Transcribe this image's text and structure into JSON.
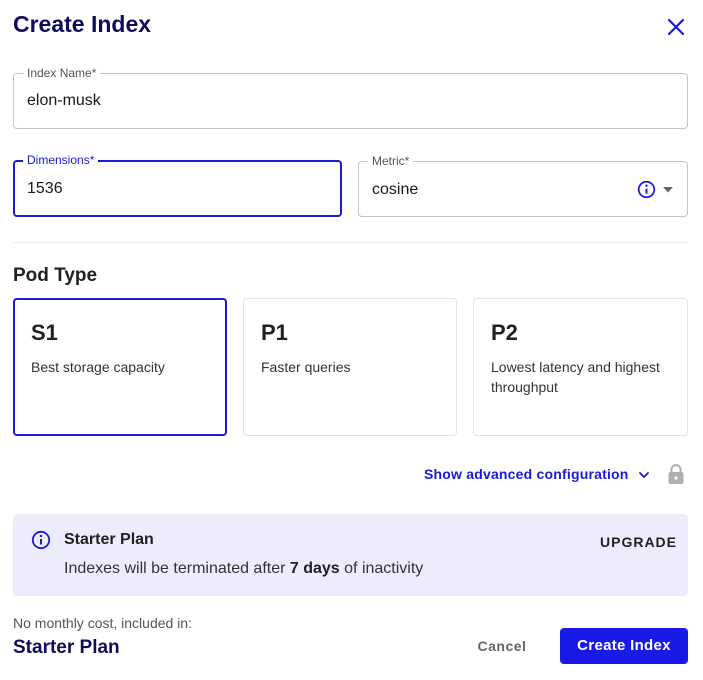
{
  "dialog": {
    "title": "Create Index"
  },
  "form": {
    "index_name": {
      "label": "Index Name",
      "required_mark": "*",
      "value": "elon-musk"
    },
    "dimensions": {
      "label": "Dimensions",
      "required_mark": "*",
      "value": "1536"
    },
    "metric": {
      "label": "Metric",
      "required_mark": "*",
      "value": "cosine"
    }
  },
  "pod_type": {
    "heading": "Pod Type",
    "options": [
      {
        "name": "S1",
        "description": "Best storage capacity",
        "selected": true
      },
      {
        "name": "P1",
        "description": "Faster queries",
        "selected": false
      },
      {
        "name": "P2",
        "description": "Lowest latency and highest throughput",
        "selected": false
      }
    ]
  },
  "advanced": {
    "label": "Show advanced configuration"
  },
  "plan_notice": {
    "title": "Starter Plan",
    "text_prefix": "Indexes will be terminated after ",
    "text_bold": "7 days",
    "text_suffix": " of inactivity",
    "upgrade_label": "UPGRADE"
  },
  "footer": {
    "cost_text": "No monthly cost, included in:",
    "plan_name": "Starter Plan",
    "cancel_label": "Cancel",
    "create_label": "Create Index"
  },
  "colors": {
    "accent": "#1a1ae6",
    "title": "#0d0d5c",
    "notice_bg": "#ececfd"
  },
  "icons": [
    "close-icon",
    "info-icon",
    "dropdown-arrow-icon",
    "chevron-down-icon",
    "lock-icon"
  ]
}
